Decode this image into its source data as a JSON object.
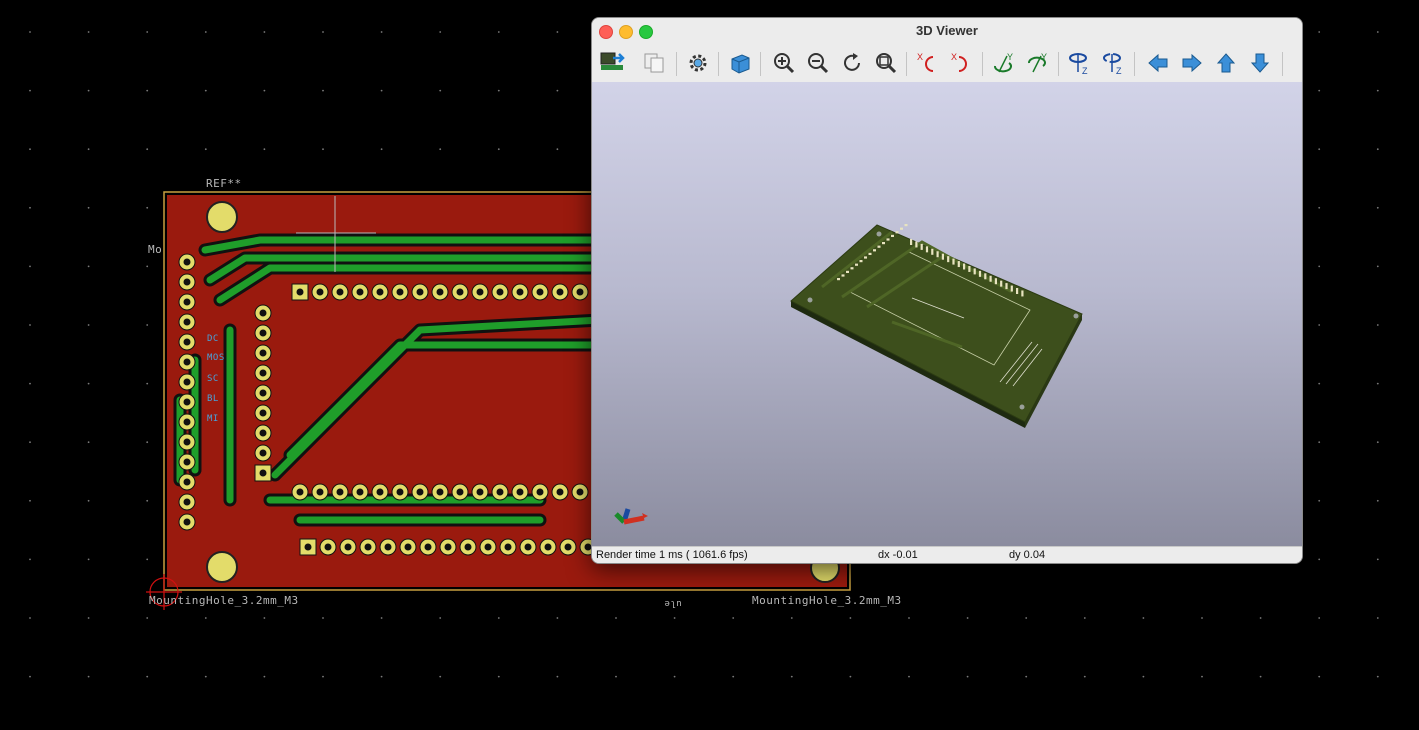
{
  "pcb_editor": {
    "ref_label": "REF**",
    "mounting_hole_left_label": "MountingHole_3.2mm_M3",
    "mounting_hole_right_label": "MountingHole_3.2mm_M3",
    "partial_label_left": "Mo",
    "partial_label_bottom": "ule",
    "silkscreen_labels": [
      "DC",
      "MOS",
      "SC",
      "BL",
      "MI"
    ],
    "colors": {
      "board": "#9a1a0e",
      "copper_track": "#1f9e2a",
      "pad": "#e3dc6a",
      "background": "#000000"
    }
  },
  "viewer_window": {
    "title": "3D Viewer",
    "toolbar": [
      {
        "name": "reload-board-icon",
        "tooltip": "Reload board"
      },
      {
        "name": "copy-image-icon",
        "tooltip": "Copy 3D image"
      },
      {
        "name": "settings-gear-icon",
        "tooltip": "Preferences"
      },
      {
        "name": "raytrace-cube-icon",
        "tooltip": "Render raytracing"
      },
      {
        "name": "zoom-in-icon",
        "tooltip": "Zoom in"
      },
      {
        "name": "zoom-out-icon",
        "tooltip": "Zoom out"
      },
      {
        "name": "redraw-icon",
        "tooltip": "Redraw"
      },
      {
        "name": "zoom-fit-icon",
        "tooltip": "Zoom to fit"
      },
      {
        "name": "rotate-x-ccw-icon",
        "tooltip": "Rotate X counterclockwise"
      },
      {
        "name": "rotate-x-cw-icon",
        "tooltip": "Rotate X clockwise"
      },
      {
        "name": "rotate-y-ccw-icon",
        "tooltip": "Rotate Y counterclockwise"
      },
      {
        "name": "rotate-y-cw-icon",
        "tooltip": "Rotate Y clockwise"
      },
      {
        "name": "rotate-z-ccw-icon",
        "tooltip": "Rotate Z counterclockwise"
      },
      {
        "name": "rotate-z-cw-icon",
        "tooltip": "Rotate Z clockwise"
      },
      {
        "name": "move-left-icon",
        "tooltip": "Move left"
      },
      {
        "name": "move-right-icon",
        "tooltip": "Move right"
      },
      {
        "name": "move-up-icon",
        "tooltip": "Move up"
      },
      {
        "name": "move-down-icon",
        "tooltip": "Move down"
      }
    ],
    "status": {
      "render_time": "Render time 1 ms ( 1061.6 fps)",
      "dx": "dx -0.01",
      "dy": "dy 0.04"
    },
    "colors": {
      "viewport_top": "#d2d3e8",
      "viewport_bottom": "#8b8c9f",
      "board_3d": "#3d4f1c"
    }
  }
}
